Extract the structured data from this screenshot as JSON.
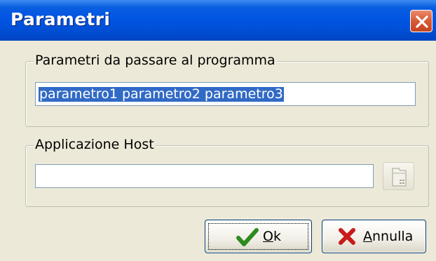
{
  "window": {
    "title": "Parametri"
  },
  "params_group": {
    "legend": "Parametri da passare al programma",
    "input_value": "parametro1 parametro2 parametro3"
  },
  "host_group": {
    "legend": "Applicazione Host",
    "input_value": ""
  },
  "buttons": {
    "ok_first": "O",
    "ok_rest": "k",
    "cancel_first": "A",
    "cancel_rest": "nnulla"
  },
  "icons": {
    "close": "close-icon",
    "browse": "folder-browse-icon",
    "ok": "checkmark-icon",
    "cancel": "red-x-icon"
  },
  "colors": {
    "titlebar": "#0054e3",
    "close_button": "#d65a34",
    "selection": "#316ac5",
    "checkmark": "#2e8b1f",
    "cancel_x": "#c81a1a"
  }
}
